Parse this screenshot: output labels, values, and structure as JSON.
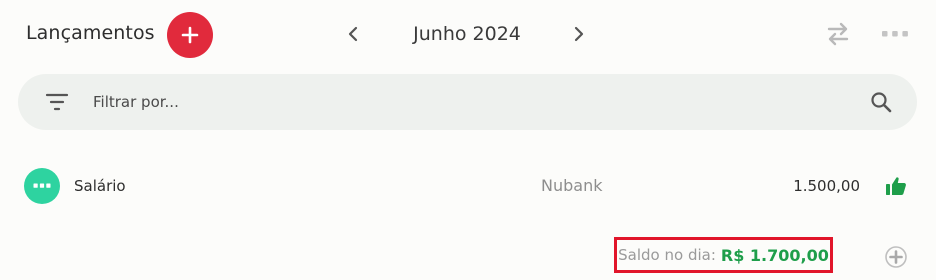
{
  "header": {
    "title": "Lançamentos",
    "month": "Junho 2024",
    "add_icon": "plus-icon",
    "prev_icon": "chevron-left-icon",
    "next_icon": "chevron-right-icon",
    "transfer_icon": "transfer-arrows-icon",
    "more_icon": "more-horizontal-icon"
  },
  "filter": {
    "placeholder": "Filtrar por...",
    "value": "",
    "filter_icon": "filter-lines-icon",
    "search_icon": "search-icon"
  },
  "transactions": [
    {
      "description": "Salário",
      "account": "Nubank",
      "amount": "1.500,00",
      "category_icon": "more-horizontal-icon",
      "status_icon": "thumbs-up-icon"
    }
  ],
  "daily_balance": {
    "label": "Saldo no dia:",
    "value": "R$ 1.700,00",
    "add_icon": "add-circle-icon"
  },
  "colors": {
    "accent_red": "#e12a3c",
    "highlight_border": "#e1152a",
    "income_green": "#1e9e4a",
    "category_teal": "#2ed3a0",
    "filter_bg": "#eef1ee",
    "page_bg": "#fcfcfa"
  }
}
